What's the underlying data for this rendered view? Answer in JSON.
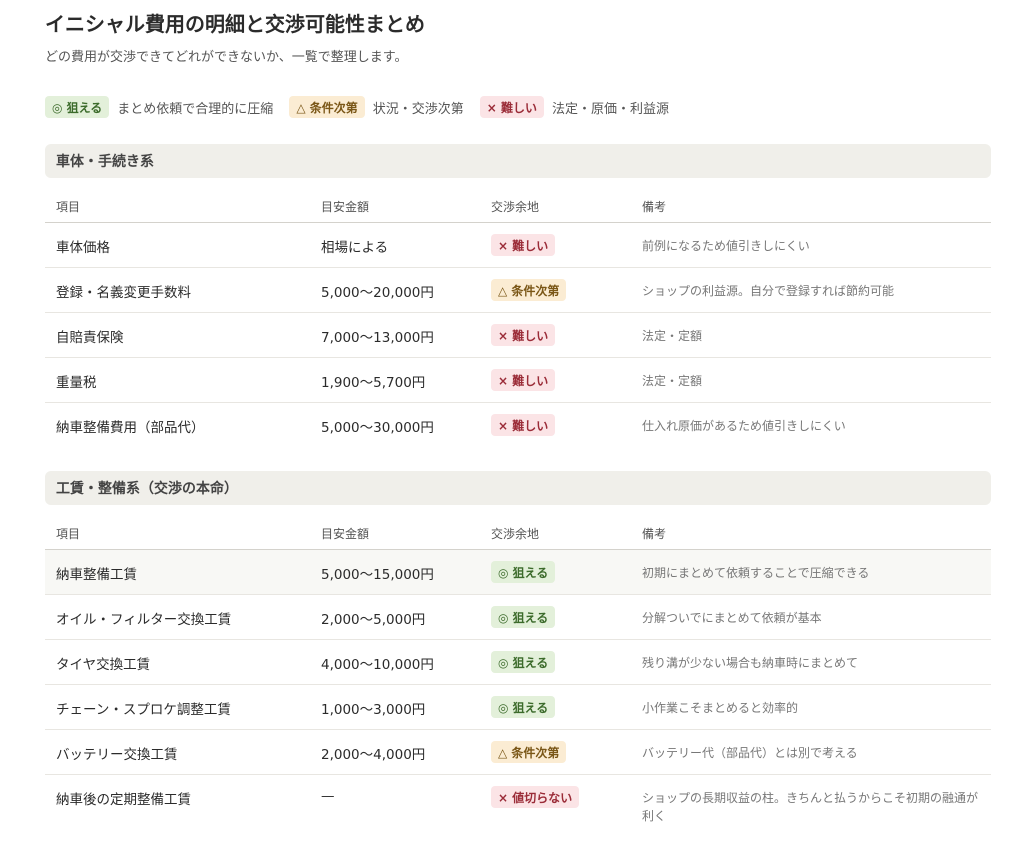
{
  "title": "イニシャル費用の明細と交渉可能性まとめ",
  "subtitle": "どの費用が交渉できてどれができないか、一覧で整理します。",
  "legend": [
    {
      "badge": "◎ 狙える",
      "type": "good",
      "text": "まとめ依頼で合理的に圧縮"
    },
    {
      "badge": "△ 条件次第",
      "type": "cond",
      "text": "状況・交渉次第"
    },
    {
      "badge": "× 難しい",
      "type": "hard",
      "text": "法定・原価・利益源"
    }
  ],
  "columns": {
    "item": "項目",
    "amount": "目安金額",
    "room": "交渉余地",
    "note": "備考"
  },
  "section1": {
    "title": "車体・手続き系",
    "rows": [
      {
        "item": "車体価格",
        "amount": "相場による",
        "badge": "× 難しい",
        "type": "hard",
        "note": "前例になるため値引きしにくい"
      },
      {
        "item": "登録・名義変更手数料",
        "amount": "5,000〜20,000円",
        "badge": "△ 条件次第",
        "type": "cond",
        "note": "ショップの利益源。自分で登録すれば節約可能"
      },
      {
        "item": "自賠責保険",
        "amount": "7,000〜13,000円",
        "badge": "× 難しい",
        "type": "hard",
        "note": "法定・定額"
      },
      {
        "item": "重量税",
        "amount": "1,900〜5,700円",
        "badge": "× 難しい",
        "type": "hard",
        "note": "法定・定額"
      },
      {
        "item": "納車整備費用（部品代）",
        "amount": "5,000〜30,000円",
        "badge": "× 難しい",
        "type": "hard",
        "note": "仕入れ原価があるため値引きしにくい"
      }
    ]
  },
  "section2": {
    "title": "工賃・整備系（交渉の本命）",
    "rows": [
      {
        "item": "納車整備工賃",
        "amount": "5,000〜15,000円",
        "badge": "◎ 狙える",
        "type": "good",
        "note": "初期にまとめて依頼することで圧縮できる"
      },
      {
        "item": "オイル・フィルター交換工賃",
        "amount": "2,000〜5,000円",
        "badge": "◎ 狙える",
        "type": "good",
        "note": "分解ついでにまとめて依頼が基本"
      },
      {
        "item": "タイヤ交換工賃",
        "amount": "4,000〜10,000円",
        "badge": "◎ 狙える",
        "type": "good",
        "note": "残り溝が少ない場合も納車時にまとめて"
      },
      {
        "item": "チェーン・スプロケ調整工賃",
        "amount": "1,000〜3,000円",
        "badge": "◎ 狙える",
        "type": "good",
        "note": "小作業こそまとめると効率的"
      },
      {
        "item": "バッテリー交換工賃",
        "amount": "2,000〜4,000円",
        "badge": "△ 条件次第",
        "type": "cond",
        "note": "バッテリー代（部品代）とは別で考える"
      },
      {
        "item": "納車後の定期整備工賃",
        "amount": "—",
        "badge": "× 値切らない",
        "type": "hard",
        "note": "ショップの長期収益の柱。きちんと払うからこそ初期の融通が利く"
      }
    ]
  }
}
